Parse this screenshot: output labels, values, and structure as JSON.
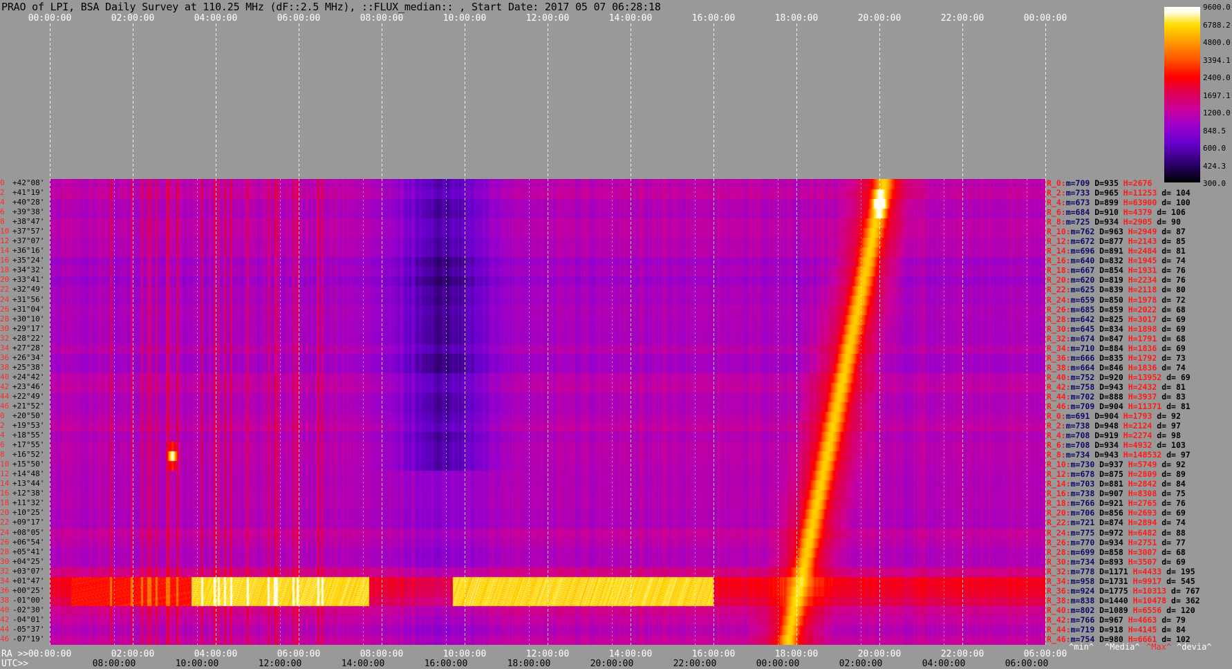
{
  "title": "PRAO of LPI, BSA Daily Survey at 110.25 MHz (dF::2.5 MHz), ::FLUX_median:: , Start Date: 2017 05 07 06:28:18",
  "top_ticks": [
    "00:00:00",
    "02:00:00",
    "04:00:00",
    "06:00:00",
    "08:00:00",
    "10:00:00",
    "12:00:00",
    "14:00:00",
    "16:00:00",
    "18:00:00",
    "20:00:00",
    "22:00:00",
    "00:00:00"
  ],
  "ra_label": "RA >>",
  "ra_ticks": [
    "00:00:00",
    "02:00:00",
    "04:00:00",
    "06:00:00",
    "08:00:00",
    "10:00:00",
    "12:00:00",
    "14:00:00",
    "16:00:00",
    "18:00:00",
    "20:00:00",
    "22:00:00",
    "06:00:00"
  ],
  "utc_label": "UTC>>",
  "utc_ticks": [
    "08:00:00",
    "10:00:00",
    "12:00:00",
    "14:00:00",
    "16:00:00",
    "18:00:00",
    "20:00:00",
    "22:00:00",
    "00:00:00",
    "02:00:00",
    "04:00:00",
    "06:00:00"
  ],
  "colorbar": {
    "ticks": [
      "9600.0",
      "6788.2",
      "4800.0",
      "3394.1",
      "2400.0",
      "1697.1",
      "1200.0",
      "848.5",
      "600.0",
      "424.3",
      "300.0"
    ],
    "colors": [
      "#000000",
      "#2a0066",
      "#6600cc",
      "#9900cc",
      "#cc0099",
      "#e0004a",
      "#ff0000",
      "#ff5500",
      "#ff9900",
      "#ffdd00",
      "#ffffe6",
      "#ffffff"
    ]
  },
  "legend": {
    "min": "^min^",
    "median": "^Media^",
    "max": "^Max^",
    "dev": "^devia^"
  },
  "rows": [
    {
      "idx": "0",
      "dec": "+42°08'"
    },
    {
      "idx": "2",
      "dec": "+41°19'"
    },
    {
      "idx": "4",
      "dec": "+40°28'"
    },
    {
      "idx": "6",
      "dec": "+39°38'"
    },
    {
      "idx": "8",
      "dec": "+38°47'"
    },
    {
      "idx": "10",
      "dec": "+37°57'"
    },
    {
      "idx": "12",
      "dec": "+37°07'"
    },
    {
      "idx": "14",
      "dec": "+36°16'"
    },
    {
      "idx": "16",
      "dec": "+35°24'"
    },
    {
      "idx": "18",
      "dec": "+34°32'"
    },
    {
      "idx": "20",
      "dec": "+33°41'"
    },
    {
      "idx": "22",
      "dec": "+32°49'"
    },
    {
      "idx": "24",
      "dec": "+31°56'"
    },
    {
      "idx": "26",
      "dec": "+31°04'"
    },
    {
      "idx": "28",
      "dec": "+30°10'"
    },
    {
      "idx": "30",
      "dec": "+29°17'"
    },
    {
      "idx": "32",
      "dec": "+28°22'"
    },
    {
      "idx": "34",
      "dec": "+27°28'"
    },
    {
      "idx": "36",
      "dec": "+26°34'"
    },
    {
      "idx": "38",
      "dec": "+25°38'"
    },
    {
      "idx": "40",
      "dec": "+24°42'"
    },
    {
      "idx": "42",
      "dec": "+23°46'"
    },
    {
      "idx": "44",
      "dec": "+22°49'"
    },
    {
      "idx": "46",
      "dec": "+21°52'"
    },
    {
      "idx": "0",
      "dec": "+20°50'"
    },
    {
      "idx": "2",
      "dec": "+19°53'"
    },
    {
      "idx": "4",
      "dec": "+18°55'"
    },
    {
      "idx": "6",
      "dec": "+17°55'"
    },
    {
      "idx": "8",
      "dec": "+16°52'"
    },
    {
      "idx": "10",
      "dec": "+15°50'"
    },
    {
      "idx": "12",
      "dec": "+14°48'"
    },
    {
      "idx": "14",
      "dec": "+13°44'"
    },
    {
      "idx": "16",
      "dec": "+12°38'"
    },
    {
      "idx": "18",
      "dec": "+11°32'"
    },
    {
      "idx": "20",
      "dec": "+10°25'"
    },
    {
      "idx": "22",
      "dec": "+09°17'"
    },
    {
      "idx": "24",
      "dec": "+08°05'"
    },
    {
      "idx": "26",
      "dec": "+06°54'"
    },
    {
      "idx": "28",
      "dec": "+05°41'"
    },
    {
      "idx": "30",
      "dec": "+04°25'"
    },
    {
      "idx": "32",
      "dec": "+03°07'"
    },
    {
      "idx": "34",
      "dec": "+01°47'"
    },
    {
      "idx": "36",
      "dec": "+00°25'"
    },
    {
      "idx": "38",
      "dec": "-01°00'"
    },
    {
      "idx": "40",
      "dec": "-02°30'"
    },
    {
      "idx": "42",
      "dec": "-04°01'"
    },
    {
      "idx": "44",
      "dec": "-05°37'"
    },
    {
      "idx": "46",
      "dec": "-07°19'"
    }
  ],
  "stats": [
    {
      "r": "R_0:",
      "m": "709",
      "D": "935",
      "H": "2676",
      "d": ""
    },
    {
      "r": "R_2:",
      "m": "733",
      "D": "965",
      "H": "11253",
      "d": "104"
    },
    {
      "r": "R_4:",
      "m": "673",
      "D": "899",
      "H": "63900",
      "d": "100"
    },
    {
      "r": "R_6:",
      "m": "684",
      "D": "910",
      "H": "4379",
      "d": "106"
    },
    {
      "r": "R_8:",
      "m": "725",
      "D": "934",
      "H": "2905",
      "d": "90"
    },
    {
      "r": "R_10:",
      "m": "762",
      "D": "963",
      "H": "2949",
      "d": "87"
    },
    {
      "r": "R_12:",
      "m": "672",
      "D": "877",
      "H": "2143",
      "d": "85"
    },
    {
      "r": "R_14:",
      "m": "696",
      "D": "891",
      "H": "2484",
      "d": "81"
    },
    {
      "r": "R_16:",
      "m": "640",
      "D": "832",
      "H": "1945",
      "d": "74"
    },
    {
      "r": "R_18:",
      "m": "667",
      "D": "854",
      "H": "1931",
      "d": "76"
    },
    {
      "r": "R_20:",
      "m": "620",
      "D": "819",
      "H": "2234",
      "d": "76"
    },
    {
      "r": "R_22:",
      "m": "625",
      "D": "839",
      "H": "2118",
      "d": "80"
    },
    {
      "r": "R_24:",
      "m": "659",
      "D": "850",
      "H": "1978",
      "d": "72"
    },
    {
      "r": "R_26:",
      "m": "685",
      "D": "859",
      "H": "2022",
      "d": "68"
    },
    {
      "r": "R_28:",
      "m": "642",
      "D": "825",
      "H": "3017",
      "d": "69"
    },
    {
      "r": "R_30:",
      "m": "645",
      "D": "834",
      "H": "1898",
      "d": "69"
    },
    {
      "r": "R_32:",
      "m": "674",
      "D": "847",
      "H": "1791",
      "d": "68"
    },
    {
      "r": "R_34:",
      "m": "710",
      "D": "884",
      "H": "1836",
      "d": "69"
    },
    {
      "r": "R_36:",
      "m": "666",
      "D": "835",
      "H": "1792",
      "d": "73"
    },
    {
      "r": "R_38:",
      "m": "664",
      "D": "846",
      "H": "1836",
      "d": "74"
    },
    {
      "r": "R_40:",
      "m": "752",
      "D": "920",
      "H": "13952",
      "d": "69"
    },
    {
      "r": "R_42:",
      "m": "758",
      "D": "943",
      "H": "2432",
      "d": "81"
    },
    {
      "r": "R_44:",
      "m": "702",
      "D": "888",
      "H": "3937",
      "d": "83"
    },
    {
      "r": "R_46:",
      "m": "709",
      "D": "904",
      "H": "11371",
      "d": "81"
    },
    {
      "r": "R_0:",
      "m": "691",
      "D": "904",
      "H": "1793",
      "d": "92"
    },
    {
      "r": "R_2:",
      "m": "738",
      "D": "948",
      "H": "2124",
      "d": "97"
    },
    {
      "r": "R_4:",
      "m": "708",
      "D": "919",
      "H": "2274",
      "d": "98"
    },
    {
      "r": "R_6:",
      "m": "708",
      "D": "934",
      "H": "4932",
      "d": "103"
    },
    {
      "r": "R_8:",
      "m": "734",
      "D": "943",
      "H": "148532",
      "d": "97"
    },
    {
      "r": "R_10:",
      "m": "730",
      "D": "937",
      "H": "5749",
      "d": "92"
    },
    {
      "r": "R_12:",
      "m": "678",
      "D": "875",
      "H": "2809",
      "d": "89"
    },
    {
      "r": "R_14:",
      "m": "703",
      "D": "881",
      "H": "2842",
      "d": "84"
    },
    {
      "r": "R_16:",
      "m": "738",
      "D": "907",
      "H": "8308",
      "d": "75"
    },
    {
      "r": "R_18:",
      "m": "766",
      "D": "921",
      "H": "2765",
      "d": "76"
    },
    {
      "r": "R_20:",
      "m": "706",
      "D": "856",
      "H": "2693",
      "d": "69"
    },
    {
      "r": "R_22:",
      "m": "721",
      "D": "874",
      "H": "2894",
      "d": "74"
    },
    {
      "r": "R_24:",
      "m": "775",
      "D": "972",
      "H": "6482",
      "d": "88"
    },
    {
      "r": "R_26:",
      "m": "770",
      "D": "934",
      "H": "2751",
      "d": "77"
    },
    {
      "r": "R_28:",
      "m": "699",
      "D": "858",
      "H": "3007",
      "d": "68"
    },
    {
      "r": "R_30:",
      "m": "734",
      "D": "893",
      "H": "3507",
      "d": "69"
    },
    {
      "r": "R_32:",
      "m": "778",
      "D": "1171",
      "H": "4433",
      "d": "195"
    },
    {
      "r": "R_34:",
      "m": "958",
      "D": "1731",
      "H": "9917",
      "d": "545"
    },
    {
      "r": "R_36:",
      "m": "924",
      "D": "1775",
      "H": "10313",
      "d": "767"
    },
    {
      "r": "R_38:",
      "m": "838",
      "D": "1440",
      "H": "10478",
      "d": "362"
    },
    {
      "r": "R_40:",
      "m": "802",
      "D": "1089",
      "H": "6556",
      "d": "120"
    },
    {
      "r": "R_42:",
      "m": "766",
      "D": "967",
      "H": "4663",
      "d": "79"
    },
    {
      "r": "R_44:",
      "m": "719",
      "D": "918",
      "H": "4145",
      "d": "84"
    },
    {
      "r": "R_46:",
      "m": "754",
      "D": "980",
      "H": "6661",
      "d": "102"
    }
  ],
  "chart_data": {
    "type": "heatmap",
    "title": "PRAO of LPI, BSA Daily Survey at 110.25 MHz (dF::2.5 MHz), ::FLUX_median:: , Start Date: 2017 05 07 06:28:18",
    "x_axis_ra_hours": [
      0,
      24
    ],
    "y_axis_declination_deg": [
      -7.32,
      42.13
    ],
    "n_rows": 48,
    "color_scale": "log",
    "color_range": [
      300.0,
      9600.0
    ],
    "grid": true,
    "row_medians": [
      935,
      965,
      899,
      910,
      934,
      963,
      877,
      891,
      832,
      854,
      819,
      839,
      850,
      859,
      825,
      834,
      847,
      884,
      835,
      846,
      920,
      943,
      888,
      904,
      904,
      948,
      919,
      934,
      943,
      937,
      875,
      881,
      907,
      921,
      856,
      874,
      972,
      934,
      858,
      893,
      1171,
      1731,
      1775,
      1440,
      1089,
      967,
      918,
      980
    ],
    "features": [
      {
        "name": "",
        "ra_hours": [
          19.9,
          20.3
        ],
        "rows": [
          0,
          4
        ],
        "level": 9000
      },
      {
        "name": "",
        "ra_hours": [
          3.5,
          7.7
        ],
        "rows": [
          41,
          43
        ],
        "level": 5000
      },
      {
        "name": "",
        "ra_hours": [
          9.7,
          16.0
        ],
        "rows": [
          41,
          43
        ],
        "level": 5000
      },
      {
        "name": "",
        "ra_hours": [
          17.5,
          20.2
        ],
        "rows": [
          0,
          47
        ],
        "level": 2200
      },
      {
        "name": "",
        "ra_hours": [
          8.2,
          10.5
        ],
        "rows": [
          1,
          26
        ],
        "level": 550
      }
    ]
  }
}
